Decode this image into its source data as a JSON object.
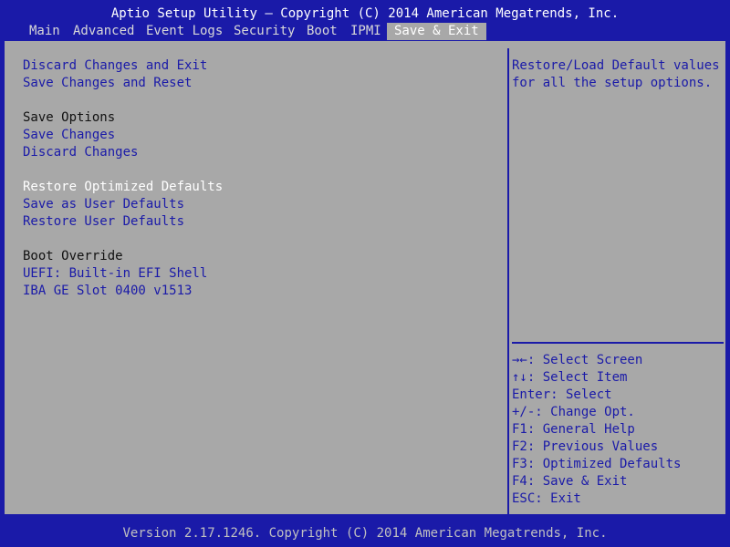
{
  "title": "Aptio Setup Utility – Copyright (C) 2014 American Megatrends, Inc.",
  "tabs": [
    {
      "label": "Main"
    },
    {
      "label": "Advanced"
    },
    {
      "label": "Event Logs"
    },
    {
      "label": "Security"
    },
    {
      "label": "Boot"
    },
    {
      "label": "IPMI"
    },
    {
      "label": "Save & Exit",
      "active": true
    }
  ],
  "menu": {
    "discard_exit": "Discard Changes and Exit",
    "save_reset": "Save Changes and Reset",
    "save_options_header": "Save Options",
    "save_changes": "Save Changes",
    "discard_changes": "Discard Changes",
    "restore_optimized": "Restore Optimized Defaults",
    "save_user_defaults": "Save as User Defaults",
    "restore_user_defaults": "Restore User Defaults",
    "boot_override_header": "Boot Override",
    "boot_uefi_shell": "UEFI: Built-in EFI Shell",
    "boot_iba": "IBA GE Slot 0400 v1513"
  },
  "help": {
    "description": "Restore/Load Default values for all the setup options.",
    "keys": [
      "→←: Select Screen",
      "↑↓: Select Item",
      "Enter: Select",
      "+/-: Change Opt.",
      "F1: General Help",
      "F2: Previous Values",
      "F3: Optimized Defaults",
      "F4: Save & Exit",
      "ESC: Exit"
    ]
  },
  "footer": "Version 2.17.1246. Copyright (C) 2014 American Megatrends, Inc.",
  "colors": {
    "background": "#1a1aa8",
    "panel": "#a8a8a8",
    "selected_text": "#ffffff",
    "item_text": "#1a1aa8"
  }
}
